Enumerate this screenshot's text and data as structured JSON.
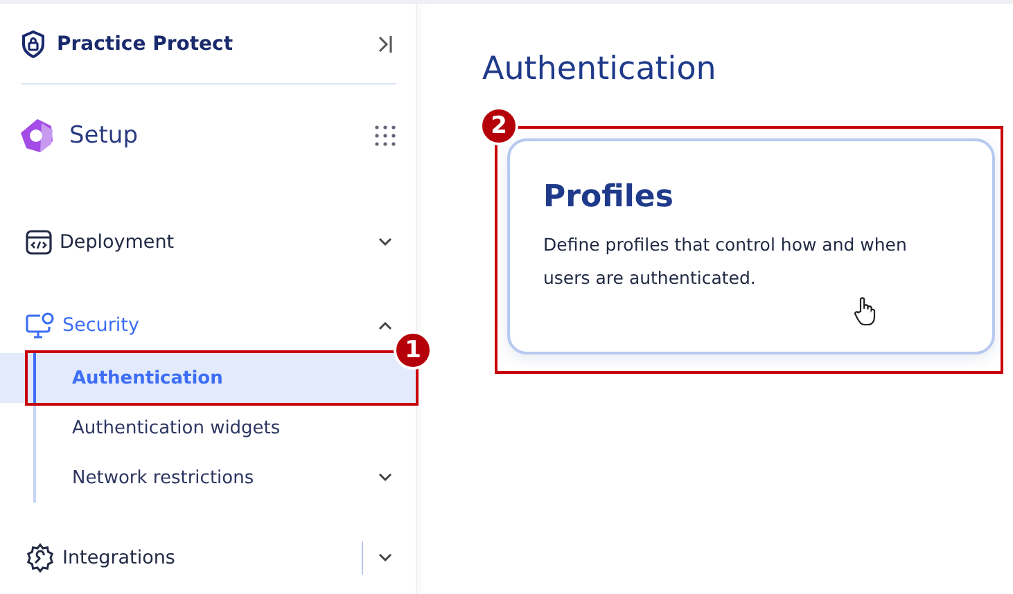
{
  "sidebar": {
    "brand": "Practice Protect",
    "app": "Setup",
    "items": [
      {
        "label": "Deployment",
        "selected": false,
        "expanded": false
      },
      {
        "label": "Security",
        "selected": true,
        "expanded": true,
        "children": [
          {
            "label": "Authentication",
            "kind": "link",
            "selected": true,
            "callout": "1"
          },
          {
            "label": "Authentication widgets",
            "kind": "link",
            "selected": false
          },
          {
            "label": "Network restrictions",
            "kind": "group",
            "selected": false,
            "expanded": false
          }
        ]
      },
      {
        "label": "Integrations",
        "selected": false,
        "expanded": false
      }
    ]
  },
  "main": {
    "title": "Authentication",
    "cards": [
      {
        "title": "Profiles",
        "description": "Define profiles that control how and when users are authenticated.",
        "callout": "2"
      }
    ]
  }
}
